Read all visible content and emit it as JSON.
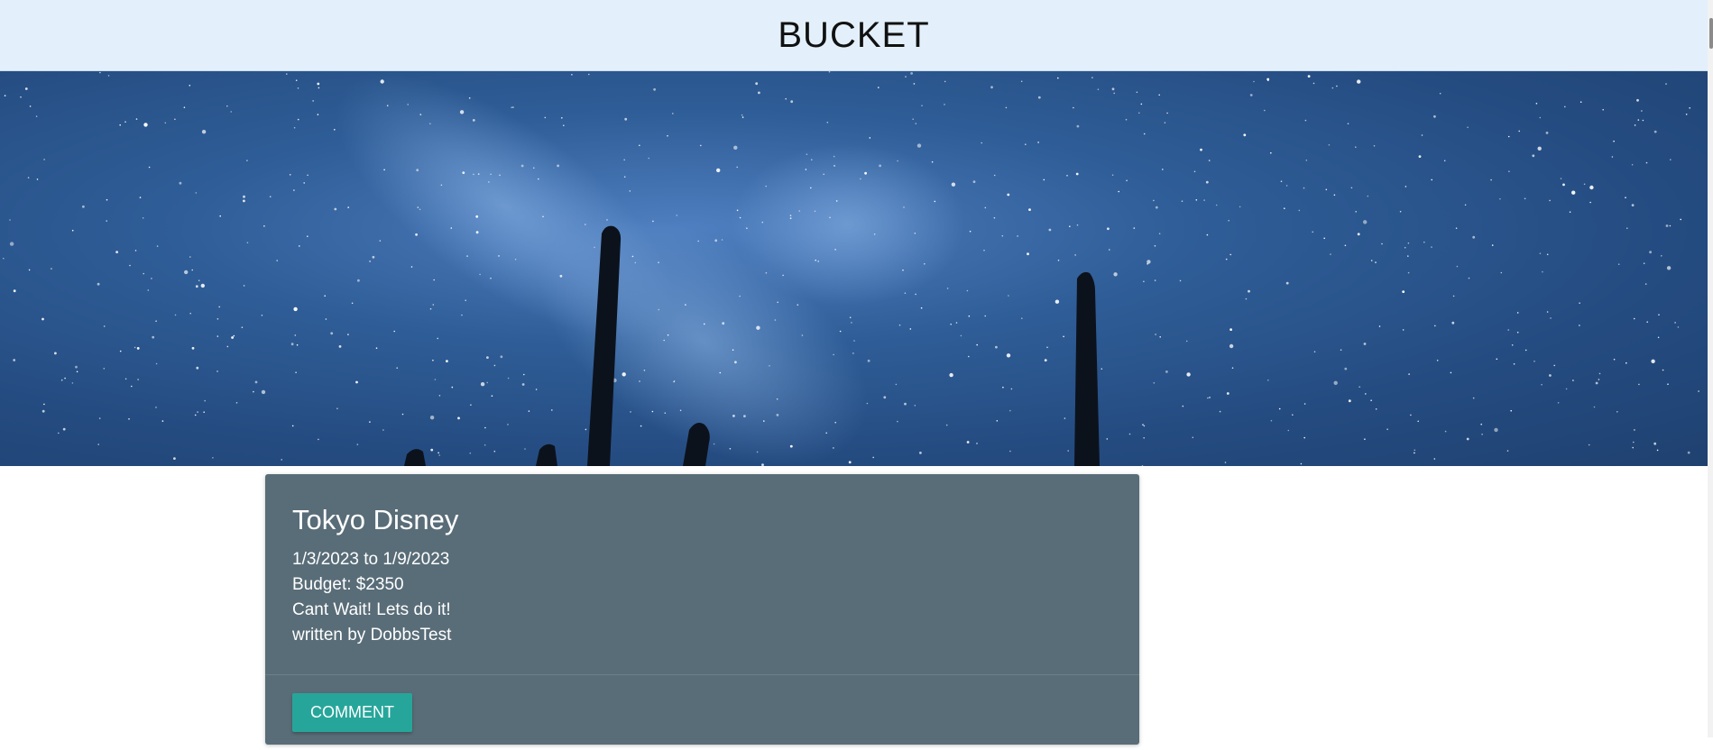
{
  "header": {
    "title": "BUCKET"
  },
  "hero": {
    "image": "starry-night-sky-with-cactus-silhouettes"
  },
  "post": {
    "title": "Tokyo Disney",
    "dates": "1/3/2023 to 1/9/2023",
    "budget": "Budget: $2350",
    "description": "Cant Wait! Lets do it!",
    "author": "written by DobbsTest",
    "comment_label": "COMMENT"
  },
  "colors": {
    "header_bg": "#e3f0fb",
    "card_bg": "#596d78",
    "button_bg": "#26a69a"
  }
}
